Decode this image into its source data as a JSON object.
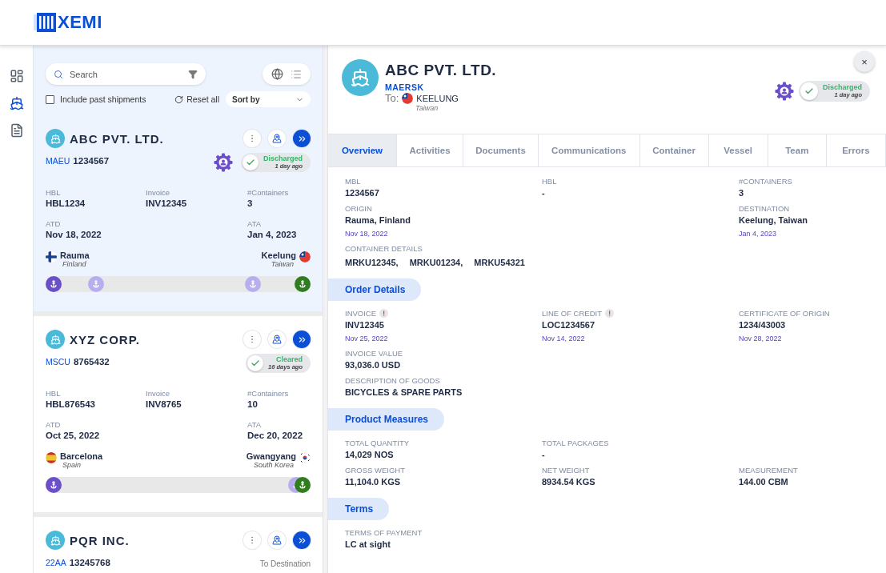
{
  "logo": {
    "text": "XEMI"
  },
  "rail": [
    {
      "kind": "dashboard",
      "selected": false
    },
    {
      "kind": "ship",
      "selected": true
    },
    {
      "kind": "document",
      "selected": false
    }
  ],
  "toolbar": {
    "search": {
      "placeholder": "Search"
    },
    "include_past": {
      "label": "Include past shipments",
      "checked": false
    },
    "reset": "Reset all",
    "sort": {
      "placeholder": "Sort by"
    }
  },
  "shipments": [
    {
      "name": "ABC PVT. LTD.",
      "selected": true,
      "prefix": "MAEU",
      "number": "1234567",
      "agent": true,
      "status": {
        "kind": "pill",
        "label": "Discharged",
        "time": "1 day ago"
      },
      "fields": [
        {
          "label": "HBL",
          "value": "HBL1234"
        },
        {
          "label": "Invoice",
          "value": "INV12345"
        },
        {
          "label": "#Containers",
          "value": "3"
        }
      ],
      "atd": {
        "label": "ATD",
        "value": "Nov 18, 2022"
      },
      "ata": {
        "label": "ATA",
        "value": "Jan 4, 2023"
      },
      "origin": {
        "city": "Rauma",
        "country": "Finland",
        "flag": {
          "kind": "fi"
        }
      },
      "destination": {
        "city": "Keelung",
        "country": "Taiwan",
        "flag": {
          "kind": "tw"
        }
      },
      "track": {
        "stops": [
          {
            "kind": "departed",
            "level": 0
          },
          {
            "kind": "pending",
            "level": 0.17
          },
          {
            "kind": "pending",
            "level": 0.8
          },
          {
            "kind": "arrived",
            "level": 1
          }
        ]
      }
    },
    {
      "name": "XYZ CORP.",
      "selected": false,
      "prefix": "MSCU",
      "number": "8765432",
      "agent": false,
      "status": {
        "kind": "pill",
        "label": "Cleared",
        "time": "16 days ago"
      },
      "fields": [
        {
          "label": "HBL",
          "value": "HBL876543"
        },
        {
          "label": "Invoice",
          "value": "INV8765"
        },
        {
          "label": "#Containers",
          "value": "10"
        }
      ],
      "atd": {
        "label": "ATD",
        "value": "Oct 25, 2022"
      },
      "ata": {
        "label": "ATA",
        "value": "Dec 20, 2022"
      },
      "origin": {
        "city": "Barcelona",
        "country": "Spain",
        "flag": {
          "kind": "es"
        }
      },
      "destination": {
        "city": "Gwangyang",
        "country": "South Korea",
        "flag": {
          "kind": "kr"
        }
      },
      "track": {
        "stops": [
          {
            "kind": "departed",
            "level": 0
          },
          {
            "kind": "pending",
            "level": 0.975
          },
          {
            "kind": "arrived",
            "level": 1
          }
        ]
      }
    },
    {
      "name": "PQR INC.",
      "selected": false,
      "prefix": "22AA",
      "number": "13245768",
      "agent": false,
      "status": {
        "kind": "text",
        "label": "To Destination"
      }
    }
  ],
  "detail": {
    "name": "ABC PVT. LTD.",
    "carrier": "MAERSK",
    "to_label": "To:",
    "destination": {
      "city": "KEELUNG",
      "country": "Taiwan",
      "flag": {
        "kind": "tw"
      }
    },
    "agent": true,
    "status": {
      "kind": "pill",
      "label": "Discharged",
      "time": "1 day ago"
    },
    "close": "×",
    "tabs": [
      {
        "label": "Overview",
        "selected": true
      },
      {
        "label": "Activities",
        "selected": false
      },
      {
        "label": "Documents",
        "selected": false
      },
      {
        "label": "Communications",
        "selected": false
      },
      {
        "label": "Container",
        "selected": false
      },
      {
        "label": "Vessel",
        "selected": false
      },
      {
        "label": "Team",
        "selected": false
      },
      {
        "label": "Errors",
        "selected": false
      }
    ],
    "sections": [
      {
        "rows": [
          [
            {
              "label": "MBL",
              "value": "1234567",
              "alert": false
            },
            {
              "label": "HBL",
              "value": "-",
              "alert": false
            },
            {
              "label": "#CONTAINERS",
              "value": "3",
              "alert": false
            }
          ],
          [
            {
              "label": "ORIGIN",
              "value": "Rauma, Finland",
              "date": "Nov 18, 2022",
              "alert": false
            },
            "",
            {
              "label": "DESTINATION",
              "value": "Keelung, Taiwan",
              "date": "Jan 4, 2023",
              "alert": false
            }
          ],
          [
            {
              "label": "CONTAINER DETAILS",
              "values": [
                "MRKU12345,",
                "MRKU01234,",
                "MRKU54321"
              ],
              "alert": false
            }
          ]
        ]
      },
      {
        "heading": "Order Details",
        "rows": [
          [
            {
              "label": "INVOICE",
              "value": "INV12345",
              "date": "Nov 25, 2022",
              "alert": true
            },
            {
              "label": "LINE OF CREDIT",
              "value": "LOC1234567",
              "date": "Nov 14, 2022",
              "alert": true
            },
            {
              "label": "CERTIFICATE OF ORIGIN",
              "value": "1234/43003",
              "date": "Nov 28, 2022",
              "alert": false
            }
          ],
          [
            {
              "label": "INVOICE VALUE",
              "value": "93,036.0 USD",
              "alert": false
            }
          ],
          [
            {
              "label": "DESCRIPTION OF GOODS",
              "value": "BICYCLES & SPARE PARTS",
              "alert": false
            }
          ]
        ]
      },
      {
        "heading": "Product Measures",
        "rows": [
          [
            {
              "label": "TOTAL QUANTITY",
              "value": "14,029 NOS",
              "alert": false
            },
            {
              "label": "TOTAL PACKAGES",
              "value": "-",
              "alert": false
            }
          ],
          [
            {
              "label": "GROSS WEIGHT",
              "value": "11,104.0 KGS",
              "alert": false
            },
            {
              "label": "NET WEIGHT",
              "value": "8934.54 KGS",
              "alert": false
            },
            {
              "label": "MEASUREMENT",
              "value": "144.00 CBM",
              "alert": false
            }
          ]
        ]
      },
      {
        "heading": "Terms",
        "rows": [
          [
            {
              "label": "TERMS OF PAYMENT",
              "value": "LC at sight",
              "alert": false
            }
          ]
        ]
      }
    ]
  }
}
